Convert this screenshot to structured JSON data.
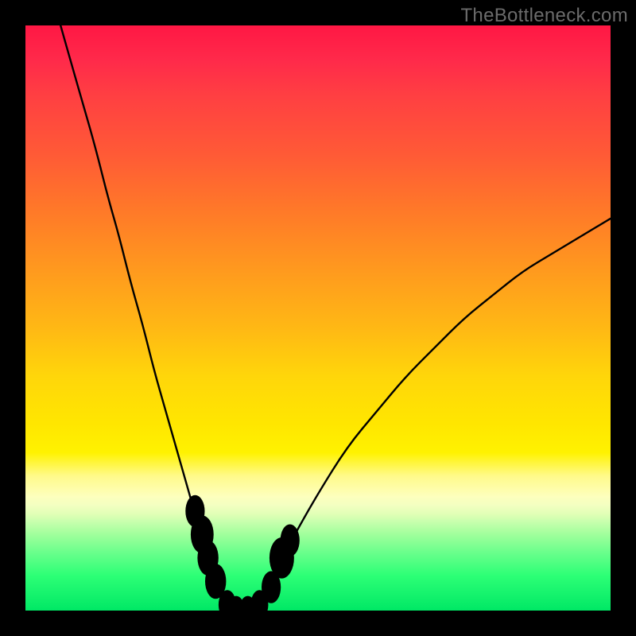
{
  "watermark": "TheBottleneck.com",
  "colors": {
    "frame": "#000000",
    "curve": "#000000",
    "marker_fill": "#e58080",
    "marker_stroke": "#d86a6a",
    "gradient_top": "#ff1744",
    "gradient_mid": "#ffe600",
    "gradient_bottom": "#00e865"
  },
  "chart_data": {
    "type": "line",
    "title": "",
    "xlabel": "",
    "ylabel": "",
    "xlim": [
      0,
      100
    ],
    "ylim": [
      0,
      100
    ],
    "grid": false,
    "description": "Single V-shaped bottleneck curve on a vertical rainbow gradient background. Y=100 at top (red), Y=0 at bottom (green). Curve reaches minimum near x≈36, y≈0. Salmon-colored marker dots cluster along the curve near the trough (roughly x 29–45, y 0–17).",
    "series": [
      {
        "name": "bottleneck-curve",
        "x": [
          6,
          8,
          10,
          12,
          14,
          16,
          18,
          20,
          22,
          24,
          26,
          28,
          30,
          32,
          34,
          36,
          38,
          40,
          42,
          44,
          46,
          50,
          55,
          60,
          65,
          70,
          75,
          80,
          85,
          90,
          95,
          100
        ],
        "y": [
          100,
          93,
          86,
          79,
          71,
          64,
          56,
          49,
          41,
          34,
          27,
          20,
          13,
          7,
          2,
          0,
          0,
          2,
          5,
          9,
          13,
          20,
          28,
          34,
          40,
          45,
          50,
          54,
          58,
          61,
          64,
          67
        ]
      }
    ],
    "markers": [
      {
        "x": 29.0,
        "y": 17,
        "r": 2.2
      },
      {
        "x": 30.2,
        "y": 13,
        "r": 2.6
      },
      {
        "x": 31.2,
        "y": 9,
        "r": 2.4
      },
      {
        "x": 32.5,
        "y": 5,
        "r": 2.4
      },
      {
        "x": 34.5,
        "y": 1,
        "r": 2.0
      },
      {
        "x": 36.0,
        "y": 0,
        "r": 2.0
      },
      {
        "x": 38.0,
        "y": 0,
        "r": 2.0
      },
      {
        "x": 40.0,
        "y": 1,
        "r": 2.0
      },
      {
        "x": 42.0,
        "y": 4,
        "r": 2.2
      },
      {
        "x": 43.8,
        "y": 9,
        "r": 2.8
      },
      {
        "x": 45.2,
        "y": 12,
        "r": 2.2
      }
    ]
  }
}
